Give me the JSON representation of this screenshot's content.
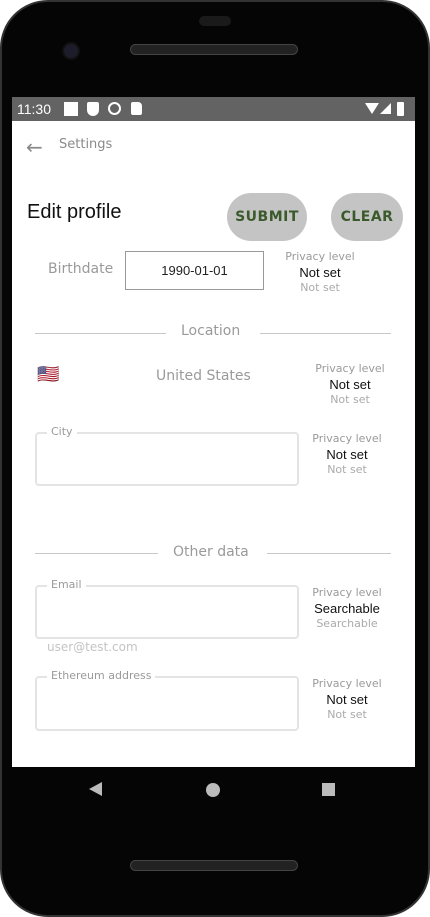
{
  "status_bar": {
    "time": "11:30"
  },
  "header": {
    "back_label": "Settings"
  },
  "page": {
    "title": "Edit profile",
    "submit_label": "SUBMIT",
    "clear_label": "CLEAR"
  },
  "birthdate": {
    "label": "Birthdate",
    "value": "1990-01-01",
    "privacy_label": "Privacy level",
    "privacy_value": "Not set",
    "privacy_sub": "Not set"
  },
  "location": {
    "section": "Location",
    "country_flag": "🇺🇸",
    "country": "United States",
    "privacy_label": "Privacy level",
    "privacy_value": "Not set",
    "privacy_sub": "Not set",
    "city": {
      "label": "City",
      "value": "",
      "privacy_label": "Privacy level",
      "privacy_value": "Not set",
      "privacy_sub": "Not set"
    }
  },
  "other": {
    "section": "Other data",
    "email": {
      "label": "Email",
      "value": "",
      "helper": "user@test.com",
      "privacy_label": "Privacy level",
      "privacy_value": "Searchable",
      "privacy_sub": "Searchable"
    },
    "ethereum": {
      "label": "Ethereum address",
      "value": "",
      "privacy_label": "Privacy level",
      "privacy_value": "Not set",
      "privacy_sub": "Not set"
    }
  },
  "colors": {
    "status_bar": "#636363",
    "button_bg": "#c4c4c4",
    "button_text": "#3b5a2c"
  }
}
